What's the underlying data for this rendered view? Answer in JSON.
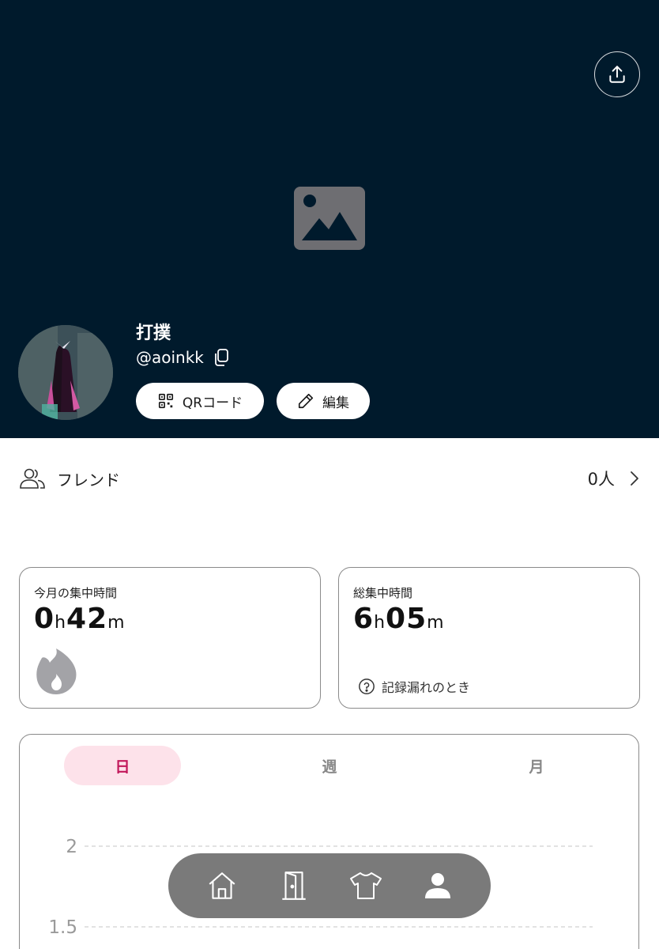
{
  "profile": {
    "name": "打撲",
    "handle": "@aoinkk",
    "qr_label": "QRコード",
    "edit_label": "編集"
  },
  "friends": {
    "label": "フレンド",
    "count": "0人"
  },
  "stats": {
    "month": {
      "title": "今月の集中時間",
      "hours": "0",
      "hours_unit": "h",
      "minutes": "42",
      "minutes_unit": "m"
    },
    "total": {
      "title": "総集中時間",
      "hours": "6",
      "hours_unit": "h",
      "minutes": "05",
      "minutes_unit": "m",
      "missing_label": "記録漏れのとき"
    }
  },
  "chart": {
    "tabs": [
      {
        "label": "日",
        "active": true
      },
      {
        "label": "週",
        "active": false
      },
      {
        "label": "月",
        "active": false
      }
    ]
  },
  "chart_data": {
    "type": "bar",
    "x": [],
    "values": [],
    "y_ticks": [
      2,
      1.5
    ],
    "ylim": [
      1.5,
      2
    ],
    "grid": true
  },
  "nav": {
    "items": [
      "home-icon",
      "door-icon",
      "shirt-icon",
      "profile-icon"
    ],
    "active": "profile-icon"
  },
  "colors": {
    "header_bg": "#001a2c",
    "accent": "#c2185b",
    "tab_active_bg": "#fde2ea",
    "nav_bg": "#7a7a7a"
  }
}
